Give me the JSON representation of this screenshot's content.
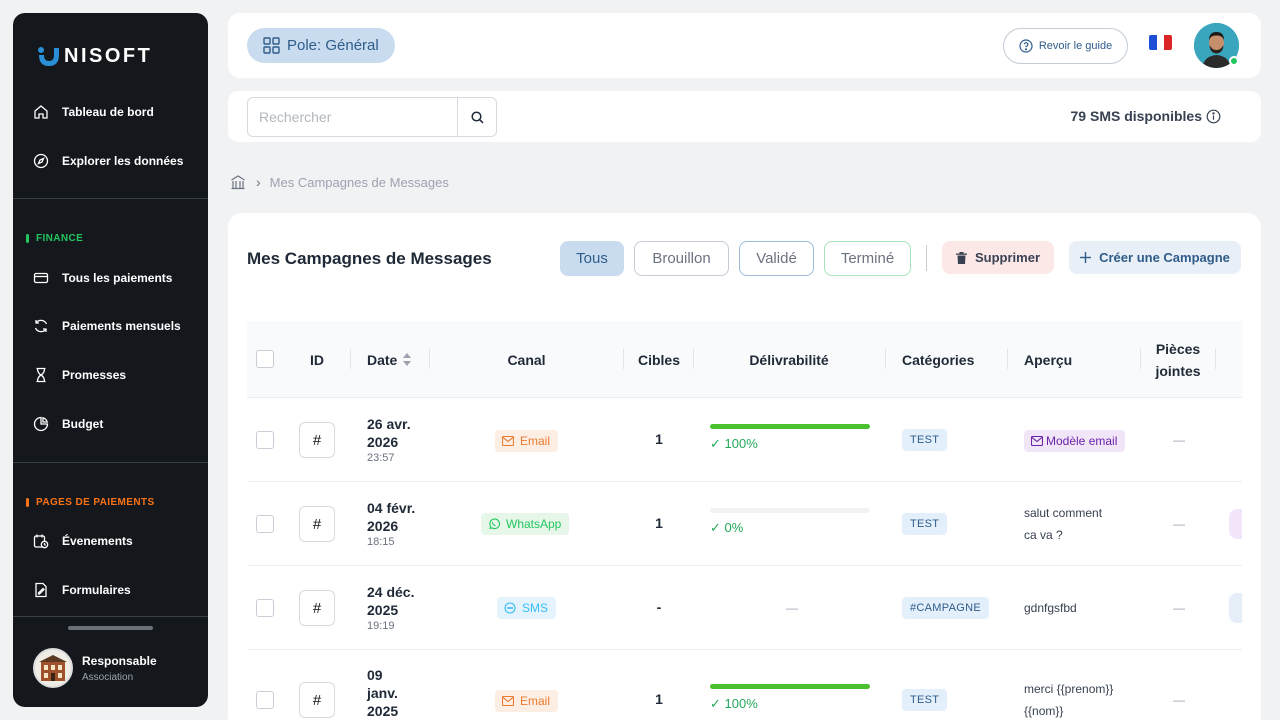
{
  "brand": {
    "name": "NISOFT"
  },
  "sidebar": {
    "main_items": [
      {
        "label": "Tableau de bord",
        "icon": "home-icon"
      },
      {
        "label": "Explorer les données",
        "icon": "compass-icon"
      }
    ],
    "finance": {
      "title": "FINANCE",
      "color": "#22c55e",
      "items": [
        {
          "label": "Tous les paiements",
          "icon": "card-icon"
        },
        {
          "label": "Paiements mensuels",
          "icon": "refresh-icon"
        },
        {
          "label": "Promesses",
          "icon": "hourglass-icon"
        },
        {
          "label": "Budget",
          "icon": "pie-chart-icon"
        }
      ]
    },
    "payment_pages": {
      "title": "PAGES DE PAIEMENTS",
      "color": "#f97316",
      "items": [
        {
          "label": "Évenements",
          "icon": "calendar-icon"
        },
        {
          "label": "Formulaires",
          "icon": "form-icon"
        }
      ]
    },
    "user": {
      "name": "Responsable",
      "role": "Association"
    }
  },
  "header": {
    "pole_label": "Pole: Général",
    "guide_label": "Revoir le guide",
    "language": "fr"
  },
  "search": {
    "placeholder": "Rechercher",
    "value": ""
  },
  "sms": {
    "label": "79 SMS disponibles"
  },
  "breadcrumb": {
    "current": "Mes Campagnes de Messages"
  },
  "page": {
    "title": "Mes Campagnes de Messages",
    "filters": [
      "Tous",
      "Brouillon",
      "Validé",
      "Terminé"
    ],
    "active_filter": "Tous",
    "delete_label": "Supprimer",
    "create_label": "Créer une Campagne"
  },
  "table": {
    "headers": {
      "id": "ID",
      "date": "Date",
      "canal": "Canal",
      "cibles": "Cibles",
      "delivrabilite": "Délivrabilité",
      "categories": "Catégories",
      "apercu": "Aperçu",
      "pieces": "Pièces jointes"
    },
    "rows": [
      {
        "id": "#",
        "date": "26 avr. 2026",
        "time": "23:57",
        "canal": "Email",
        "cibles": "1",
        "progress": 100,
        "pct": "✓ 100%",
        "categorie": "TEST",
        "apercu": "Modèle email",
        "apercu_type": "template",
        "pieces": "—"
      },
      {
        "id": "#",
        "date": "04 févr. 2026",
        "time": "18:15",
        "canal": "WhatsApp",
        "cibles": "1",
        "progress": 0,
        "pct": "✓ 0%",
        "categorie": "TEST",
        "apercu": "salut comment ca va ?",
        "apercu_type": "text",
        "pieces": "—"
      },
      {
        "id": "#",
        "date": "24 déc. 2025",
        "time": "19:19",
        "canal": "SMS",
        "cibles": "-",
        "progress": null,
        "pct": "—",
        "categorie": "#CAMPAGNE",
        "apercu": "gdnfgsfbd",
        "apercu_type": "text",
        "pieces": "—"
      },
      {
        "id": "#",
        "date": "09 janv. 2025",
        "time": "",
        "canal": "Email",
        "cibles": "1",
        "progress": 100,
        "pct": "✓ 100%",
        "categorie": "TEST",
        "apercu": "merci {{prenom}} {{nom}}",
        "apercu_type": "text",
        "pieces": "—"
      }
    ]
  },
  "colors": {
    "accent": "#2f5c8a",
    "email": "#f97316",
    "whatsapp": "#22c55e",
    "sms": "#38bdf8",
    "success": "#4ac12e"
  }
}
